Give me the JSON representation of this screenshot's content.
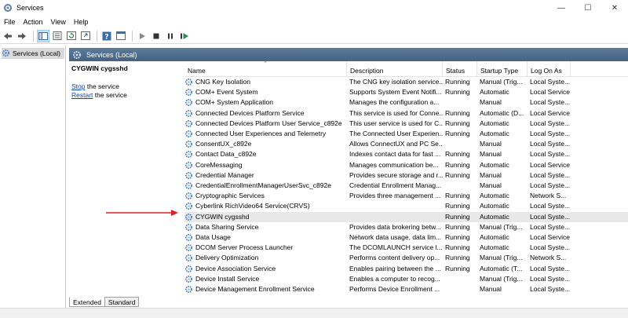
{
  "window": {
    "title": "Services"
  },
  "menu": [
    "File",
    "Action",
    "View",
    "Help"
  ],
  "tree": {
    "root_label": "Services (Local)"
  },
  "header": {
    "title": "Services (Local)"
  },
  "detail": {
    "service_name": "CYGWIN cygsshd",
    "stop_link": "Stop",
    "stop_suffix": " the service",
    "restart_link": "Restart",
    "restart_suffix": " the service"
  },
  "columns": [
    "Name",
    "Description",
    "Status",
    "Startup Type",
    "Log On As"
  ],
  "services": [
    {
      "name": "CNG Key Isolation",
      "description": "The CNG key isolation service...",
      "status": "Running",
      "startup": "Manual (Trig...",
      "logon": "Local Syste..."
    },
    {
      "name": "COM+ Event System",
      "description": "Supports System Event Notifi...",
      "status": "Running",
      "startup": "Automatic",
      "logon": "Local Service"
    },
    {
      "name": "COM+ System Application",
      "description": "Manages the configuration a...",
      "status": "",
      "startup": "Manual",
      "logon": "Local Syste..."
    },
    {
      "name": "Connected Devices Platform Service",
      "description": "This service is used for Conne...",
      "status": "Running",
      "startup": "Automatic (D...",
      "logon": "Local Service"
    },
    {
      "name": "Connected Devices Platform User Service_c892e",
      "description": "This user service is used for C...",
      "status": "Running",
      "startup": "Automatic",
      "logon": "Local Syste..."
    },
    {
      "name": "Connected User Experiences and Telemetry",
      "description": "The Connected User Experien...",
      "status": "Running",
      "startup": "Automatic",
      "logon": "Local Syste..."
    },
    {
      "name": "ConsentUX_c892e",
      "description": "Allows ConnectUX and PC Se...",
      "status": "",
      "startup": "Manual",
      "logon": "Local Syste..."
    },
    {
      "name": "Contact Data_c892e",
      "description": "Indexes contact data for fast ...",
      "status": "Running",
      "startup": "Manual",
      "logon": "Local Syste..."
    },
    {
      "name": "CoreMessaging",
      "description": "Manages communication be...",
      "status": "Running",
      "startup": "Automatic",
      "logon": "Local Service"
    },
    {
      "name": "Credential Manager",
      "description": "Provides secure storage and r...",
      "status": "Running",
      "startup": "Manual",
      "logon": "Local Syste..."
    },
    {
      "name": "CredentialEnrollmentManagerUserSvc_c892e",
      "description": "Credential Enrollment Manag...",
      "status": "",
      "startup": "Manual",
      "logon": "Local Syste..."
    },
    {
      "name": "Cryptographic Services",
      "description": "Provides three management ...",
      "status": "Running",
      "startup": "Automatic",
      "logon": "Network S..."
    },
    {
      "name": "Cyberlink RichVideo64 Service(CRVS)",
      "description": "",
      "status": "Running",
      "startup": "Automatic",
      "logon": "Local Syste..."
    },
    {
      "name": "CYGWIN cygsshd",
      "description": "",
      "status": "Running",
      "startup": "Automatic",
      "logon": "Local Syste..."
    },
    {
      "name": "Data Sharing Service",
      "description": "Provides data brokering betw...",
      "status": "Running",
      "startup": "Manual (Trig...",
      "logon": "Local Syste..."
    },
    {
      "name": "Data Usage",
      "description": "Network data usage, data lim...",
      "status": "Running",
      "startup": "Automatic",
      "logon": "Local Service"
    },
    {
      "name": "DCOM Server Process Launcher",
      "description": "The DCOMLAUNCH service l...",
      "status": "Running",
      "startup": "Automatic",
      "logon": "Local Syste..."
    },
    {
      "name": "Delivery Optimization",
      "description": "Performs content delivery op...",
      "status": "Running",
      "startup": "Manual (Trig...",
      "logon": "Network S..."
    },
    {
      "name": "Device Association Service",
      "description": "Enables pairing between the ...",
      "status": "Running",
      "startup": "Automatic (T...",
      "logon": "Local Syste..."
    },
    {
      "name": "Device Install Service",
      "description": "Enables a computer to recog...",
      "status": "",
      "startup": "Manual (Trig...",
      "logon": "Local Syste..."
    },
    {
      "name": "Device Management Enrollment Service",
      "description": "Performs Device Enrollment ...",
      "status": "",
      "startup": "Manual",
      "logon": "Local Syste..."
    }
  ],
  "selected_row": 13,
  "tabs": [
    "Extended",
    "Standard"
  ],
  "colors": {
    "header_bar": "#4f6d8b",
    "arrow": "#e02020",
    "link": "#0645ad",
    "gear": "#4a7fc0"
  }
}
